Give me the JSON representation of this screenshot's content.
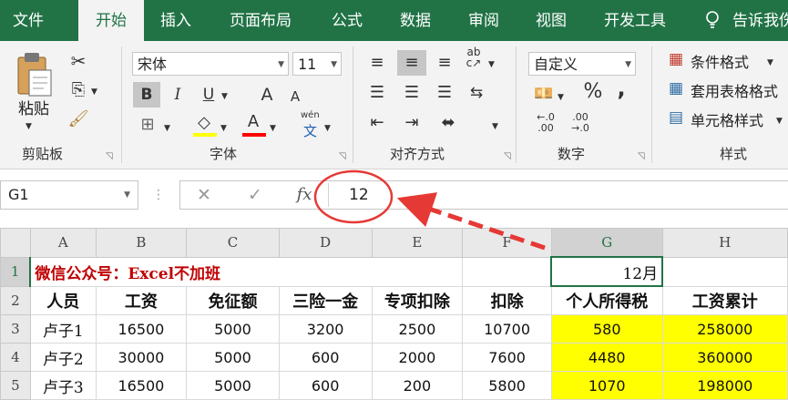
{
  "ribbon_tabs": [
    "文件",
    "开始",
    "插入",
    "页面布局",
    "公式",
    "数据",
    "审阅",
    "视图",
    "开发工具",
    "告诉我伤"
  ],
  "clipboard": {
    "paste_label": "粘贴",
    "group_label": "剪贴板"
  },
  "font": {
    "name": "宋体",
    "size": "11",
    "bold": "B",
    "italic": "I",
    "underline": "U",
    "grow": "A",
    "shrink": "A",
    "font_color": "A",
    "phonetic": "wén",
    "phonetic_char": "文",
    "group_label": "字体"
  },
  "alignment": {
    "group_label": "对齐方式"
  },
  "number": {
    "format": "自定义",
    "percent": "%",
    "comma": ",",
    "increase_decimal": "←.0\n.00",
    "decrease_decimal": ".00\n→.0",
    "group_label": "数字"
  },
  "styles": {
    "conditional": "条件格式",
    "table_format": "套用表格格式",
    "cell_styles": "单元格样式",
    "group_label": "样式"
  },
  "formula_bar": {
    "name_box": "G1",
    "cancel": "✕",
    "enter": "✓",
    "fx": "fx",
    "content": "12"
  },
  "colors": {
    "excel_green": "#217346",
    "highlight_yellow": "#ffff00",
    "title_red": "#c00000",
    "annotation_red": "#e53935"
  },
  "sheet": {
    "columns": [
      "A",
      "B",
      "C",
      "D",
      "E",
      "F",
      "G",
      "H"
    ],
    "row_numbers": [
      "1",
      "2",
      "3",
      "4",
      "5"
    ],
    "title": "微信公众号：Excel不加班",
    "active_cell_value": "12月",
    "headers": [
      "人员",
      "工资",
      "免征额",
      "三险一金",
      "专项扣除",
      "扣除",
      "个人所得税",
      "工资累计"
    ],
    "rows": [
      [
        "卢子1",
        "16500",
        "5000",
        "3200",
        "2500",
        "10700",
        "580",
        "258000"
      ],
      [
        "卢子2",
        "30000",
        "5000",
        "600",
        "2000",
        "7600",
        "4480",
        "360000"
      ],
      [
        "卢子3",
        "16500",
        "5000",
        "600",
        "200",
        "5800",
        "1070",
        "198000"
      ]
    ]
  }
}
